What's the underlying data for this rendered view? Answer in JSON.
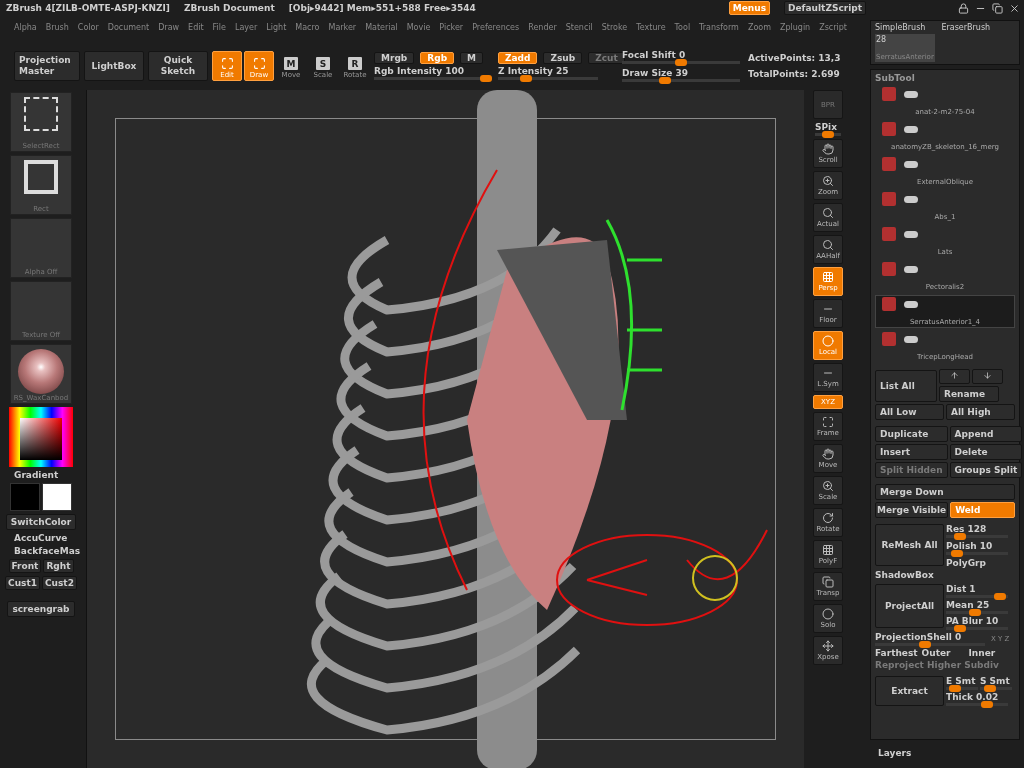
{
  "title_bar": {
    "app": "ZBrush 4[ZILB-OMTE-ASPJ-KNZI]",
    "document": "ZBrush Document",
    "stats": "[Obj▸9442] Mem▸551+588 Free▸3544",
    "menus": {
      "label": "Menus",
      "selected": true
    },
    "script": "DefaultZScript"
  },
  "menu_bar": [
    "Alpha",
    "Brush",
    "Color",
    "Document",
    "Draw",
    "Edit",
    "File",
    "Layer",
    "Light",
    "Macro",
    "Marker",
    "Material",
    "Movie",
    "Picker",
    "Preferences",
    "Render",
    "Stencil",
    "Stroke",
    "Texture",
    "Tool",
    "Transform",
    "Zoom",
    "Zplugin",
    "Zscript"
  ],
  "toolbar": {
    "buttons": [
      {
        "label": "Projection Master"
      },
      {
        "label": "LightBox"
      },
      {
        "label": "Quick Sketch"
      }
    ],
    "modes": [
      {
        "label": "Edit",
        "selected": true
      },
      {
        "label": "Draw",
        "selected": true
      },
      {
        "label": "Move",
        "key": "M",
        "selected": false
      },
      {
        "label": "Scale",
        "key": "S",
        "selected": false
      },
      {
        "label": "Rotate",
        "key": "R",
        "selected": false
      }
    ],
    "color_toggles": [
      {
        "label": "Mrgb",
        "selected": false
      },
      {
        "label": "Rgb",
        "selected": true
      },
      {
        "label": "M",
        "selected": false
      }
    ],
    "z_toggles": [
      {
        "label": "Zadd",
        "selected": true,
        "disabled": false
      },
      {
        "label": "Zsub",
        "selected": false,
        "disabled": false
      },
      {
        "label": "Zcut",
        "selected": false,
        "disabled": true
      }
    ],
    "sliders": [
      {
        "label": "Rgb Intensity",
        "value": "100",
        "level": 1.0
      },
      {
        "label": "Z Intensity",
        "value": "25",
        "level": 0.25
      },
      {
        "label": "Focal Shift",
        "value": "0",
        "level": 0.5
      },
      {
        "label": "Draw Size",
        "value": "39",
        "level": 0.35
      }
    ],
    "active_points": "ActivePoints: 13,3",
    "total_points": "TotalPoints: 2.699"
  },
  "left_shelf": {
    "tiles": [
      {
        "label": "SelectRect",
        "kind": "select"
      },
      {
        "label": "Rect",
        "kind": "rect"
      },
      {
        "label": "Alpha Off",
        "kind": "empty"
      },
      {
        "label": "Texture Off",
        "kind": "empty"
      },
      {
        "label": "RS_WaxCanbod",
        "kind": "material"
      }
    ],
    "gradient": "Gradient",
    "controls": [
      {
        "label": "SwitchColor",
        "kind": "button"
      },
      {
        "label": "AccuCurve",
        "kind": "text"
      },
      {
        "label": "BackfaceMas",
        "kind": "text"
      }
    ],
    "pairs": [
      [
        "Front",
        "Rght"
      ],
      [
        "Cust1",
        "Cust2"
      ]
    ],
    "screengrab": "screengrab"
  },
  "right_shelf": [
    {
      "label": "BPR",
      "selected": false,
      "disabled": true
    },
    {
      "label": "SPix",
      "kind": "slider",
      "level": 0.5
    },
    {
      "label": "Scroll",
      "selected": false,
      "disabled": false
    },
    {
      "label": "Zoom",
      "selected": false,
      "disabled": false
    },
    {
      "label": "Actual",
      "selected": false,
      "disabled": false
    },
    {
      "label": "AAHalf",
      "selected": false,
      "disabled": false
    },
    {
      "label": "Persp",
      "selected": true,
      "disabled": false
    },
    {
      "label": "Floor",
      "selected": false,
      "disabled": false
    },
    {
      "label": "Local",
      "selected": true,
      "disabled": false
    },
    {
      "label": "L.Sym",
      "selected": false,
      "disabled": false
    },
    {
      "label": "XYZ",
      "selected": true,
      "disabled": false,
      "kind": "small"
    },
    {
      "label": "Frame",
      "selected": false,
      "disabled": false
    },
    {
      "label": "Move",
      "selected": false,
      "disabled": false
    },
    {
      "label": "Scale",
      "selected": false,
      "disabled": false
    },
    {
      "label": "Rotate",
      "selected": false,
      "disabled": false
    },
    {
      "label": "PolyF",
      "selected": false,
      "disabled": false
    },
    {
      "label": "Transp",
      "selected": false,
      "disabled": false
    },
    {
      "label": "Solo",
      "selected": false,
      "disabled": false
    },
    {
      "label": "Xpose",
      "selected": false,
      "disabled": false
    }
  ],
  "brush_popup": {
    "brushes": [
      "SimpleBrush",
      "EraserBrush"
    ],
    "tool_count": "28",
    "tool_name": "SerratusAnterior"
  },
  "subtool": {
    "title": "SubTool",
    "items": [
      {
        "name": "anat-2-m2-75-04",
        "selected": false
      },
      {
        "name": "anatomyZB_skeleton_16_merg",
        "selected": false
      },
      {
        "name": "ExternalOblique",
        "selected": false
      },
      {
        "name": "Abs_1",
        "selected": false
      },
      {
        "name": "Lats",
        "selected": false
      },
      {
        "name": "Pectoralis2",
        "selected": false
      },
      {
        "name": "SerratusAnterior1_4",
        "selected": true
      },
      {
        "name": "TricepLongHead",
        "selected": false
      }
    ],
    "list_all": "List All",
    "rename": "Rename",
    "all_low": "All Low",
    "all_high": "All High",
    "actions": [
      {
        "label": "Duplicate",
        "selected": false,
        "disabled": false
      },
      {
        "label": "Append",
        "selected": false,
        "disabled": false
      },
      {
        "label": "Insert",
        "selected": false,
        "disabled": false
      },
      {
        "label": "Delete",
        "selected": false,
        "disabled": false
      },
      {
        "label": "Split Hidden",
        "selected": false,
        "disabled": true
      },
      {
        "label": "Groups Split",
        "selected": false,
        "disabled": false
      }
    ],
    "merge_down": "Merge Down",
    "merge_visible": "Merge Visible",
    "weld": {
      "label": "Weld",
      "selected": true
    },
    "remesh": "ReMesh All",
    "res": {
      "label": "Res",
      "value": "128",
      "level": 0.15
    },
    "polish": {
      "label": "Polish",
      "value": "10",
      "level": 0.1
    },
    "polygrp": "PolyGrp",
    "shadowbox": "ShadowBox",
    "project_all": "ProjectAll",
    "dist": {
      "label": "Dist",
      "value": "1",
      "level": 0.95
    },
    "mean": {
      "label": "Mean",
      "value": "25",
      "level": 0.45
    },
    "pa_blur": {
      "label": "PA Blur",
      "value": "10",
      "level": 0.15
    },
    "projection_shell": {
      "label": "ProjectionShell",
      "value": "0",
      "level": 0.45
    },
    "xyz": "X Y Z",
    "farthest": "Farthest",
    "outer": "Outer",
    "inner": "Inner",
    "reproject": "Reproject Higher Subdiv",
    "extract": "Extract",
    "e_smt": {
      "label": "E Smt",
      "level": 0.15
    },
    "s_smt": {
      "label": "S Smt",
      "level": 0.2
    },
    "thick": {
      "label": "Thick",
      "value": "0.02",
      "level": 0.7
    }
  },
  "layers": "Layers"
}
